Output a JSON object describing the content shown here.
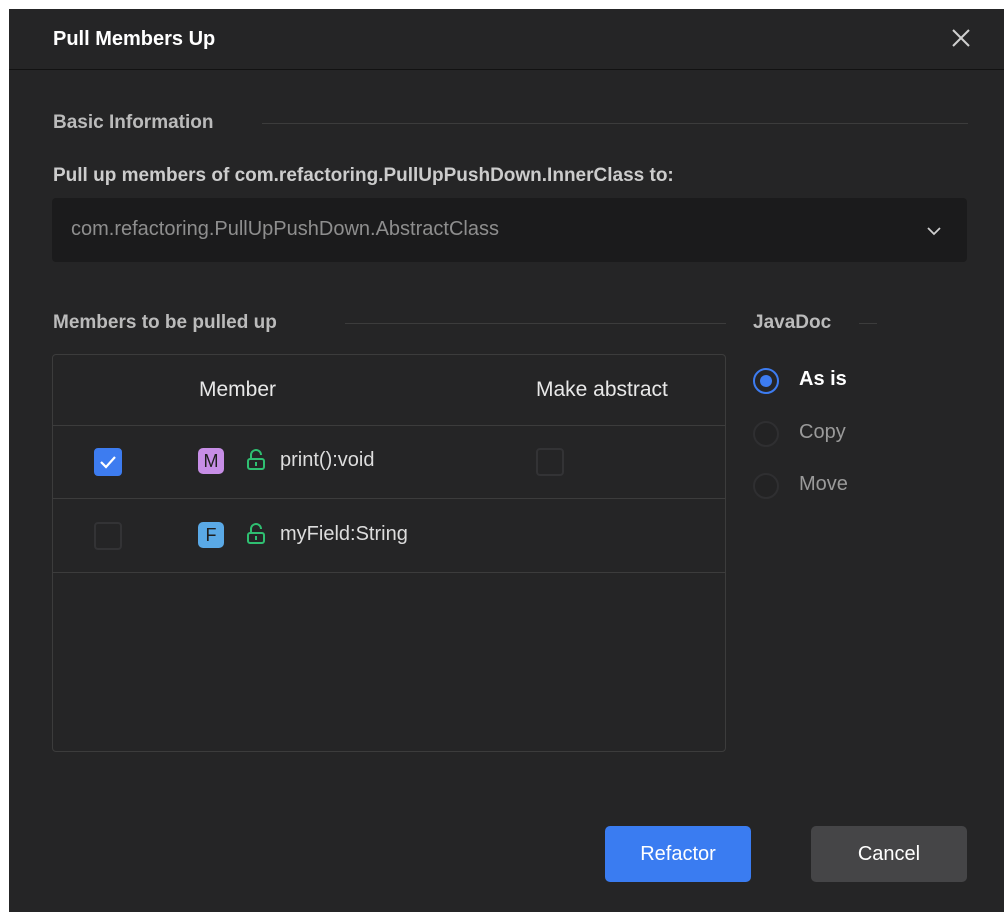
{
  "dialog": {
    "title": "Pull Members Up"
  },
  "basic_info": {
    "legend": "Basic Information",
    "target_label": "Pull up members of com.refactoring.PullUpPushDown.InnerClass to:",
    "target_value": "com.refactoring.PullUpPushDown.AbstractClass"
  },
  "members": {
    "legend": "Members to be pulled up",
    "columns": {
      "member": "Member",
      "make_abstract": "Make abstract"
    },
    "rows": [
      {
        "selected": true,
        "kind_badge": "M",
        "kind_color": "#c78ee6",
        "visibility_icon": "unlock-icon",
        "name": "print():void",
        "make_abstract": false
      },
      {
        "selected": false,
        "kind_badge": "F",
        "kind_color": "#5aa9e6",
        "visibility_icon": "unlock-icon",
        "name": "myField:String"
      }
    ]
  },
  "javadoc": {
    "legend": "JavaDoc",
    "options": [
      {
        "label": "As is",
        "selected": true
      },
      {
        "label": "Copy",
        "selected": false
      },
      {
        "label": "Move",
        "selected": false
      }
    ]
  },
  "buttons": {
    "refactor": "Refactor",
    "cancel": "Cancel"
  },
  "colors": {
    "accent": "#3d7cf0",
    "unlock_green": "#2fbf71"
  }
}
